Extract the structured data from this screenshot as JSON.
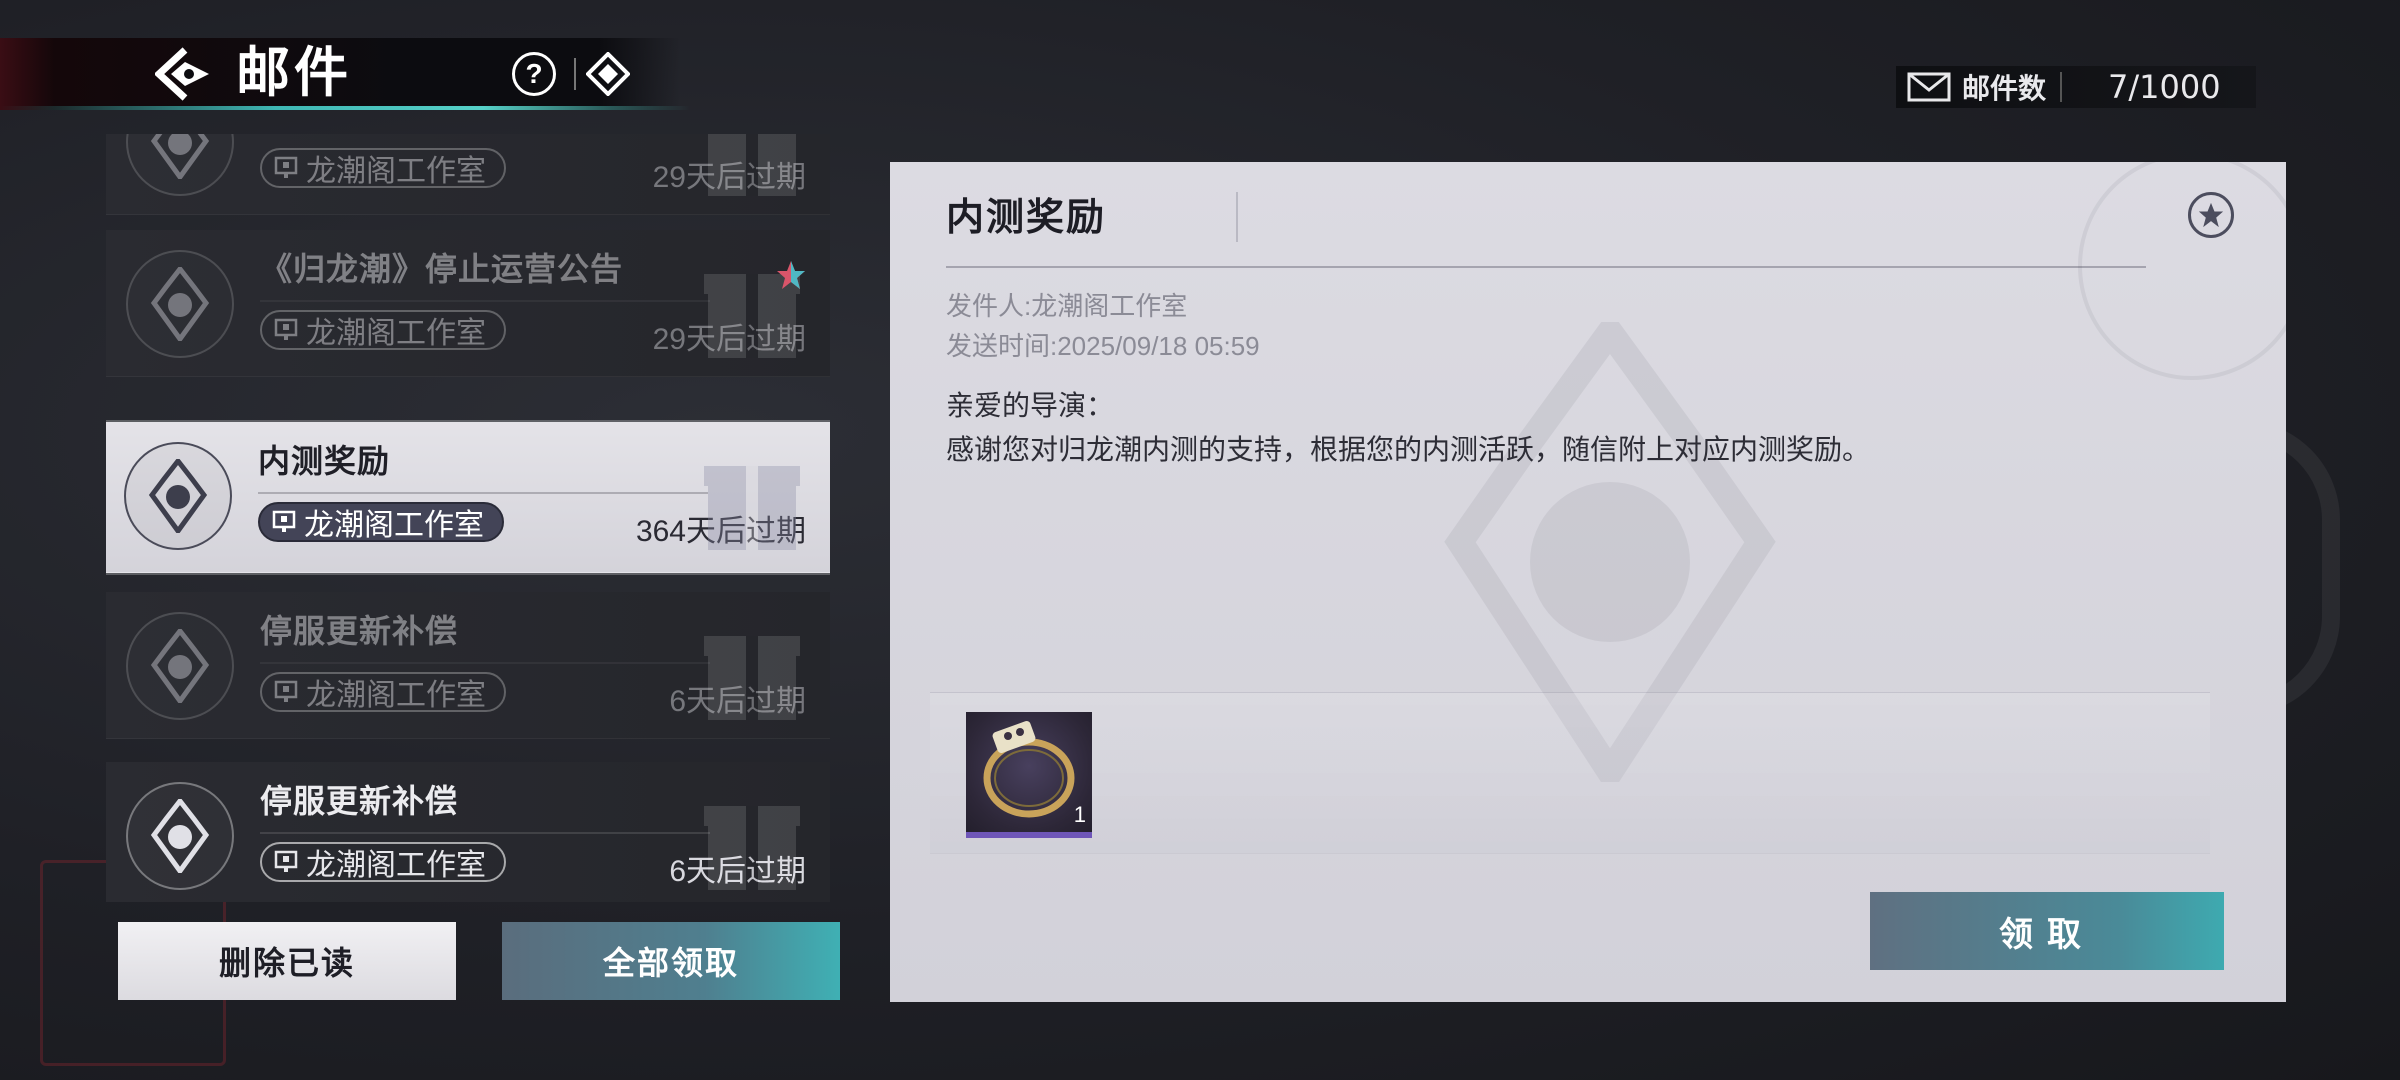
{
  "header": {
    "title": "邮件",
    "back_icon": "back-arrow-icon",
    "help_label": "?",
    "help_icon": "question-circle-icon",
    "diamond_icon": "diamond-eye-icon"
  },
  "mail_count": {
    "label": "邮件数",
    "value": "7/1000",
    "icon": "envelope-icon"
  },
  "mails": [
    {
      "title": "",
      "sender": "龙潮阁工作室",
      "expire": "29天后过期",
      "read": true
    },
    {
      "title": "《归龙潮》停止运营公告",
      "sender": "龙潮阁工作室",
      "expire": "29天后过期",
      "read": true,
      "starred": true
    },
    {
      "title": "内测奖励",
      "sender": "龙潮阁工作室",
      "expire": "364天后过期",
      "active": true
    },
    {
      "title": "停服更新补偿",
      "sender": "龙潮阁工作室",
      "expire": "6天后过期",
      "read": true
    },
    {
      "title": "停服更新补偿",
      "sender": "龙潮阁工作室",
      "expire": "6天后过期",
      "read": false
    }
  ],
  "actions": {
    "delete_read": "删除已读",
    "claim_all": "全部领取"
  },
  "detail": {
    "title": "内测奖励",
    "sender_line": "发件人:龙潮阁工作室",
    "time_line": "发送时间:2025/09/18 05:59",
    "greeting": "亲爱的导演：",
    "body": "感谢您对归龙潮内测的支持，根据您的内测活跃，随信附上对应内测奖励。",
    "attachment_count": "1",
    "claim_label": "领取"
  },
  "colors": {
    "accent_teal": "#3fb7b4",
    "header_red": "#3a0d14",
    "rarity_purple": "#6f56b8"
  }
}
